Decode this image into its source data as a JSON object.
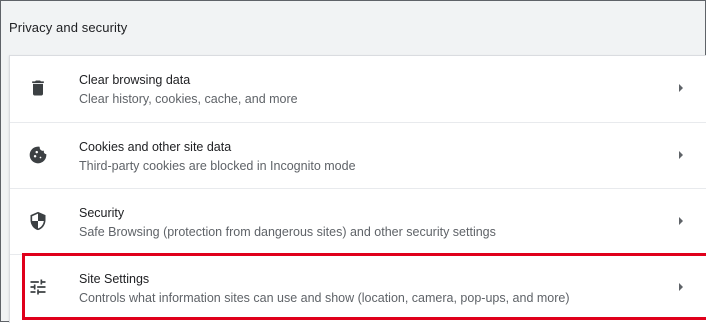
{
  "section": {
    "title": "Privacy and security"
  },
  "rows": [
    {
      "title": "Clear browsing data",
      "subtitle": "Clear history, cookies, cache, and more",
      "icon": "trash-icon"
    },
    {
      "title": "Cookies and other site data",
      "subtitle": "Third-party cookies are blocked in Incognito mode",
      "icon": "cookie-icon"
    },
    {
      "title": "Security",
      "subtitle": "Safe Browsing (protection from dangerous sites) and other security settings",
      "icon": "shield-icon"
    },
    {
      "title": "Site Settings",
      "subtitle": "Controls what information sites can use and show (location, camera, pop-ups, and more)",
      "icon": "tune-sliders-icon",
      "highlighted": true
    }
  ],
  "colors": {
    "highlight": "#e0001b",
    "background": "#f1f3f4",
    "card": "#ffffff",
    "text_primary": "#202124",
    "text_secondary": "#5f6368"
  }
}
